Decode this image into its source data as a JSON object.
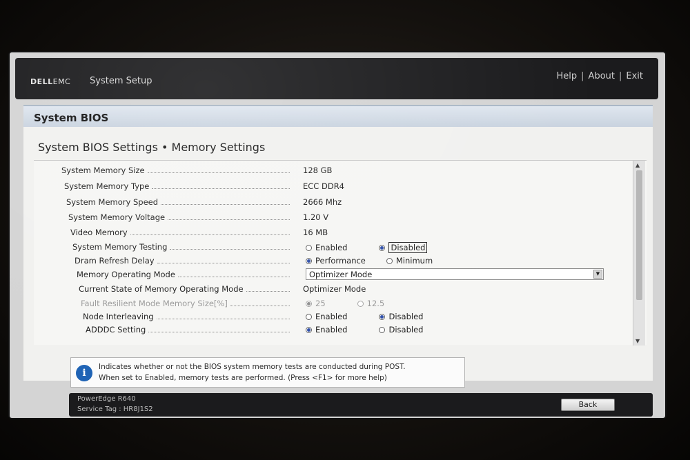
{
  "header": {
    "logo_bold": "DELL",
    "logo_light": "EMC",
    "title": "System Setup",
    "links": [
      "Help",
      "About",
      "Exit"
    ],
    "separator": "|"
  },
  "section": {
    "title": "System BIOS"
  },
  "breadcrumb": "System BIOS Settings • Memory Settings",
  "settings": [
    {
      "label": "System Memory Size",
      "value": "128 GB"
    },
    {
      "label": "System Memory Type",
      "value": "ECC DDR4"
    },
    {
      "label": "System Memory Speed",
      "value": "2666 Mhz"
    },
    {
      "label": "System Memory Voltage",
      "value": "1.20 V"
    },
    {
      "label": "Video Memory",
      "value": "16 MB"
    },
    {
      "label": "System Memory Testing",
      "options": [
        "Enabled",
        "Disabled"
      ],
      "selected": "Disabled"
    },
    {
      "label": "Dram Refresh Delay",
      "options": [
        "Performance",
        "Minimum"
      ],
      "selected": "Performance"
    },
    {
      "label": "Memory Operating Mode",
      "dropdown": "Optimizer Mode"
    },
    {
      "label": "Current State of Memory Operating Mode",
      "value": "Optimizer Mode"
    },
    {
      "label": "Fault Resilient Mode Memory Size[%]",
      "options": [
        "25",
        "12.5"
      ],
      "selected": "25",
      "disabled": true
    },
    {
      "label": "Node Interleaving",
      "options": [
        "Enabled",
        "Disabled"
      ],
      "selected": "Disabled"
    },
    {
      "label": "ADDDC Setting",
      "options": [
        "Enabled",
        "Disabled"
      ],
      "selected": "Enabled"
    }
  ],
  "help": {
    "line1": "Indicates whether or not the BIOS system memory tests are conducted during POST.",
    "line2": "When set to Enabled, memory tests are performed. (Press <F1> for more help)"
  },
  "footer": {
    "model": "PowerEdge R640",
    "service_tag": "Service Tag : HR8J1S2",
    "back_label": "Back"
  },
  "colors": {
    "accent": "#2f4fa9",
    "info": "#1f63b5",
    "bar": "#1b1b1d"
  }
}
